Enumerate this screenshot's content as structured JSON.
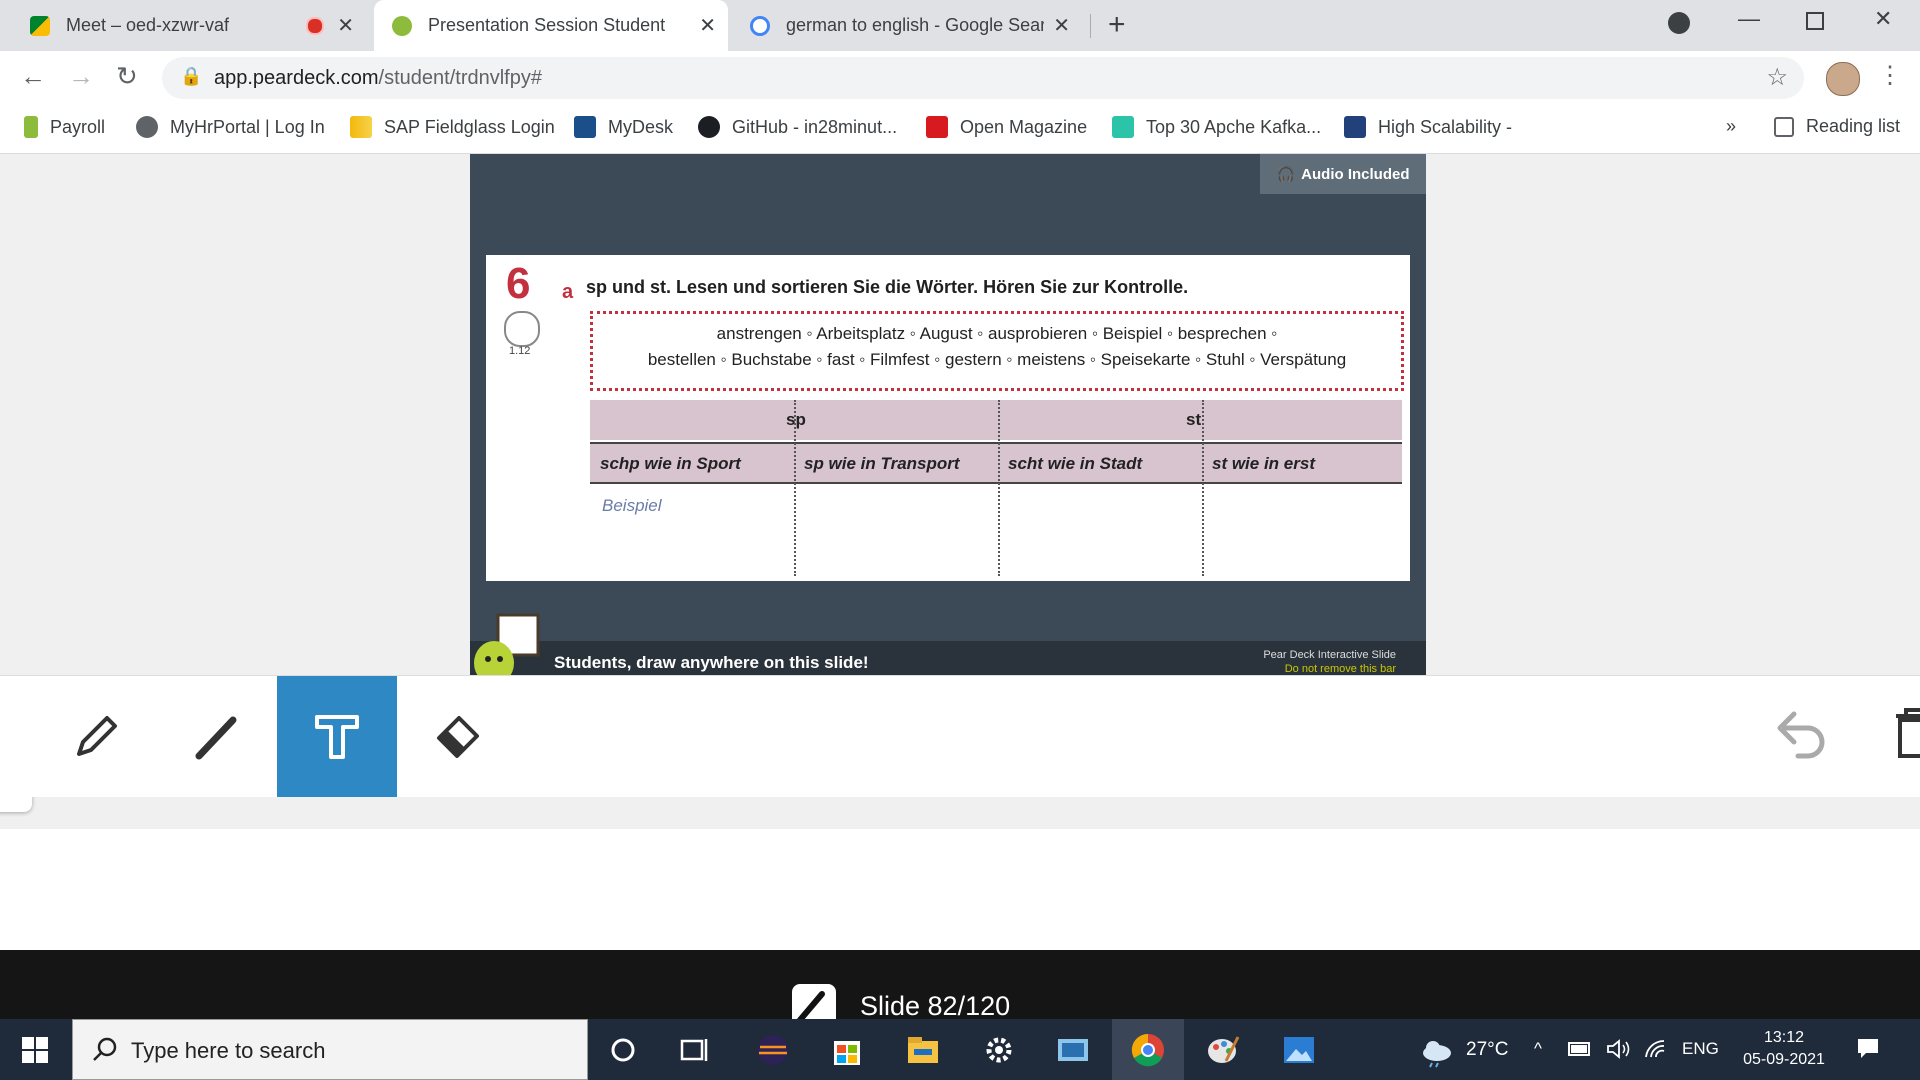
{
  "browser": {
    "tabs": [
      {
        "title": "Meet – oed-xzwr-vaf",
        "active": false
      },
      {
        "title": "Presentation Session Student",
        "active": true
      },
      {
        "title": "german to english - Google Sear",
        "active": false
      }
    ],
    "new_tab_icon": "plus-icon",
    "url_domain": "app.peardeck.com",
    "url_path": "/student/trdnvlfpy#",
    "bookmarks": [
      "Payroll",
      "MyHrPortal | Log In",
      "SAP Fieldglass Login",
      "MyDesk",
      "GitHub - in28minut...",
      "Open Magazine",
      "Top 30 Apche Kafka...",
      "High Scalability -"
    ],
    "bookmarks_overflow": "»",
    "reading_list": "Reading list"
  },
  "slide": {
    "audio_badge": "Audio Included",
    "exercise_number": "6",
    "track": "1.12",
    "part_letter": "a",
    "instruction": "sp und st. Lesen und sortieren Sie die Wörter. Hören Sie zur Kontrolle.",
    "words_line1": "anstrengen ◦ Arbeitsplatz ◦ August ◦ ausprobieren ◦ Beispiel ◦ besprechen ◦",
    "words_line2": "bestellen ◦ Buchstabe ◦ fast ◦ Filmfest ◦ gestern ◦ meistens ◦ Speisekarte ◦ Stuhl ◦ Verspätung",
    "table": {
      "group_sp": "sp",
      "group_st": "st",
      "columns": [
        "schp wie in Sport",
        "sp wie in Transport",
        "scht wie in Stadt",
        "st wie in erst"
      ],
      "example": "Beispiel"
    },
    "footer_prompt": "Students, draw anywhere on this slide!",
    "footer_brand": "Pear Deck Interactive Slide",
    "footer_note": "Do not remove this bar"
  },
  "palette": {
    "selected": "#111111",
    "colors": [
      "#ffffff",
      "#111111",
      "#d81e28",
      "#ee9310",
      "#fbc82c",
      "#4bb044",
      "#1769b4",
      "#a041c1",
      "#e43ed6",
      "#e70e6a",
      "#f68c00",
      "#efcd00",
      "#dfe80b",
      "#05d57a",
      "#0ac3e6",
      "#5a2411",
      "#8b5436",
      "#b97446",
      "#b57c6c",
      "#e2a08c",
      "#dc9a50",
      "#d7a27b",
      "#c8ad97",
      "#efc4a1",
      "#f5dcc0"
    ]
  },
  "tools": [
    "pencil-icon",
    "marker-icon",
    "text-tool-icon",
    "eraser-icon"
  ],
  "active_tool": "text-tool-icon",
  "slide_counter": "Slide 82/120",
  "taskbar": {
    "search_placeholder": "Type here to search",
    "temperature": "27°C",
    "language": "ENG",
    "time": "13:12",
    "date": "05-09-2021"
  }
}
